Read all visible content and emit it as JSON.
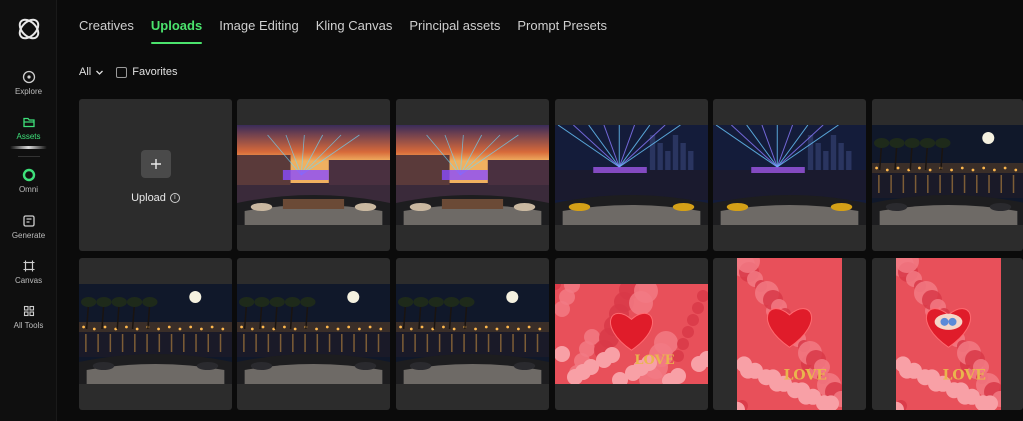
{
  "sidebar": {
    "logo": "swirl-logo-icon",
    "items": [
      {
        "label": "Explore",
        "icon": "compass-icon"
      },
      {
        "label": "Assets",
        "icon": "folder-icon",
        "active": true
      },
      {
        "label": "Omni",
        "icon": "omni-ring-icon"
      },
      {
        "label": "Generate",
        "icon": "generate-icon"
      },
      {
        "label": "Canvas",
        "icon": "canvas-icon"
      },
      {
        "label": "All Tools",
        "icon": "grid-icon"
      }
    ]
  },
  "tabs": [
    "Creatives",
    "Uploads",
    "Image Editing",
    "Kling Canvas",
    "Principal assets",
    "Prompt Presets"
  ],
  "active_tab": "Uploads",
  "filter": {
    "dropdown_label": "All",
    "favorites_label": "Favorites",
    "favorites_checked": false
  },
  "upload_card": {
    "label": "Upload",
    "icon": "plus-icon"
  },
  "colors": {
    "accent": "#4be36d",
    "background": "#0b0b0b",
    "card": "#2c2c2c"
  },
  "assets": [
    {
      "scene": "sunset-laser-yacht",
      "love_text": ""
    },
    {
      "scene": "sunset-laser-yacht",
      "love_text": ""
    },
    {
      "scene": "night-laser-yacht",
      "love_text": ""
    },
    {
      "scene": "night-laser-yacht",
      "love_text": ""
    },
    {
      "scene": "moon-palms-yacht",
      "love_text": ""
    },
    {
      "scene": "moon-palms-yacht",
      "love_text": ""
    },
    {
      "scene": "moon-palms-yacht",
      "love_text": ""
    },
    {
      "scene": "moon-palms-yacht",
      "love_text": ""
    },
    {
      "scene": "heart-roses-landscape",
      "love_text": "LOVE"
    },
    {
      "scene": "heart-roses-portrait",
      "love_text": "LOVE"
    },
    {
      "scene": "heart-box-portrait",
      "love_text": "LOVE"
    }
  ]
}
